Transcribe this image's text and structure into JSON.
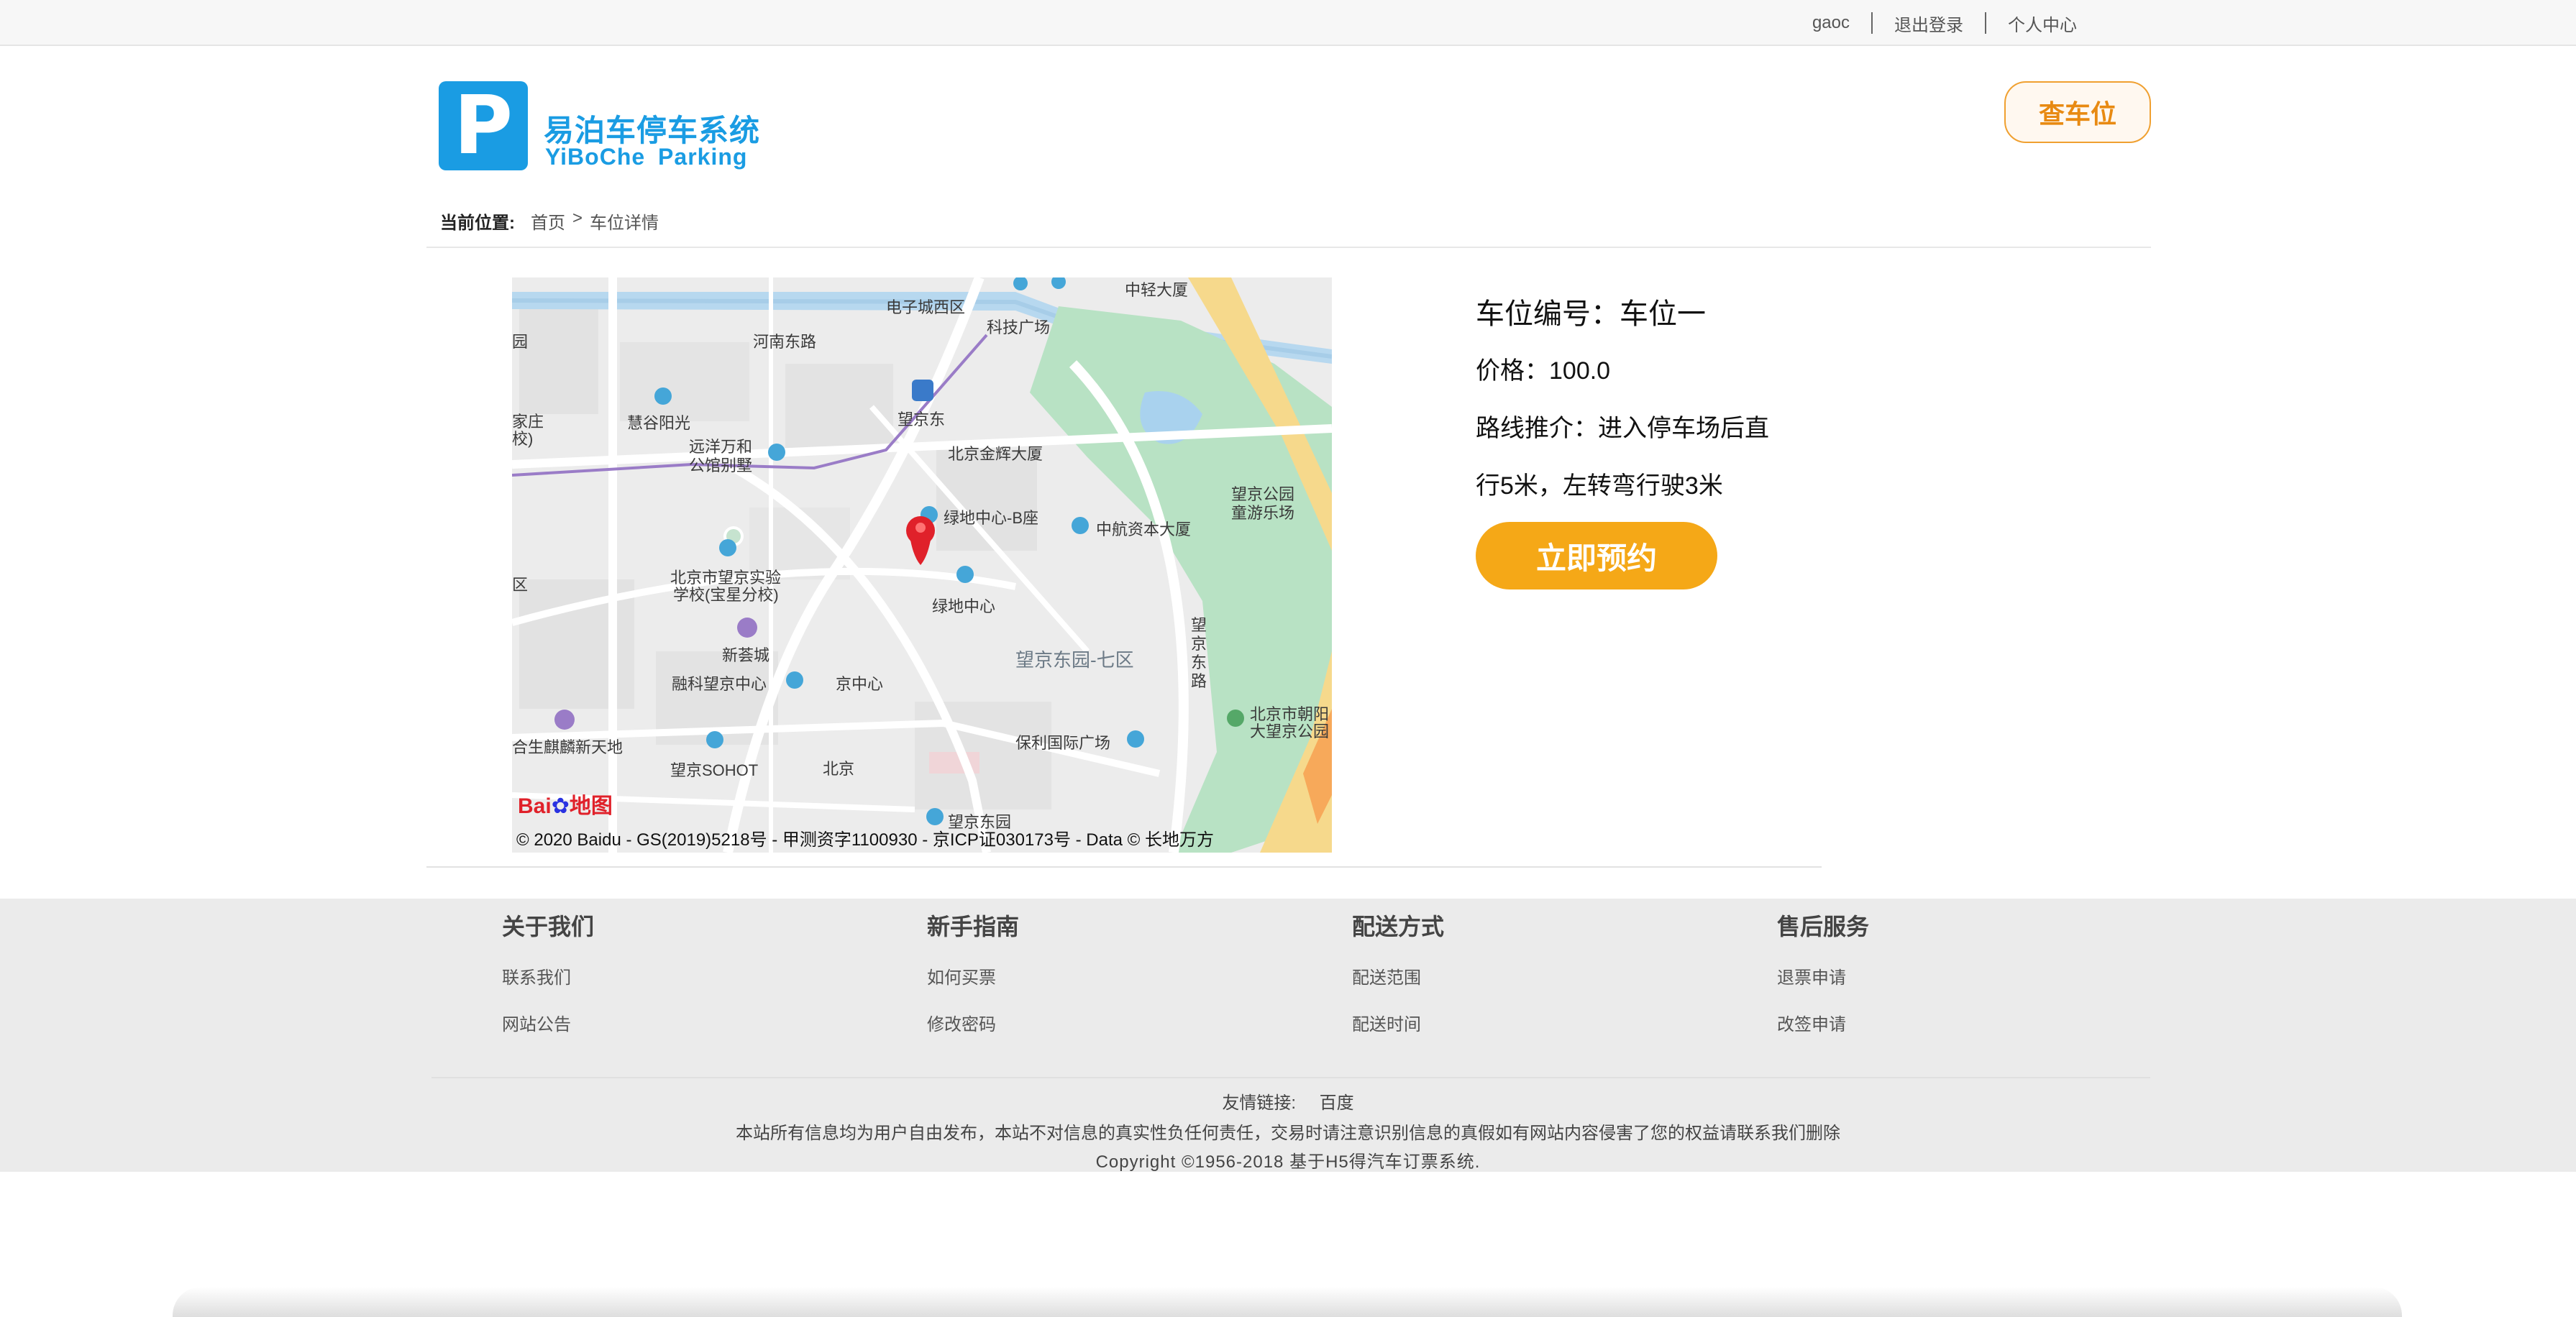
{
  "topbar": {
    "username": "gaoc",
    "logout": "退出登录",
    "profile": "个人中心"
  },
  "header": {
    "logo_letter": "P",
    "logo_cn": "易泊车停车系统",
    "logo_en": "YiBoChe Parking",
    "find_button": "查车位"
  },
  "breadcrumb": {
    "label": "当前位置:",
    "items": [
      "首页",
      "车位详情"
    ],
    "separator": ">"
  },
  "map": {
    "copyright": "© 2020 Baidu - GS(2019)5218号 - 甲测资字1100930 - 京ICP证030173号 - Data © 长地万方",
    "logo_text": "Bai",
    "logo_text2": "地图",
    "labels": [
      "河南东路",
      "电子城西区",
      "科技广场",
      "中轻大厦",
      "望京东",
      "慧谷阳光",
      "远洋万和",
      "公馆别墅",
      "家庄",
      "校)",
      "北京金辉大厦",
      "绿地中心-B座",
      "中航资本大厦",
      "望京公园",
      "童游乐场",
      "北京市望京实验",
      "学校(宝星分校)",
      "绿地中心",
      "新荟城",
      "融科望京中心",
      "京中心",
      "望京东园-七区",
      "望",
      "京",
      "东",
      "路",
      "北京市朝阳",
      "大望京公园",
      "保利国际广场",
      "合生麒麟新天地",
      "望京SOHOT",
      "北京",
      "望京东园",
      "园",
      "区"
    ]
  },
  "detail": {
    "space_no": "车位编号：车位一",
    "price": "价格：100.0",
    "route_line1": "路线推介：进入停车场后直",
    "route_line2": "行5米，左转弯行驶3米",
    "reserve_button": "立即预约"
  },
  "footer": {
    "columns": [
      {
        "title": "关于我们",
        "links": [
          "联系我们",
          "网站公告"
        ]
      },
      {
        "title": "新手指南",
        "links": [
          "如何买票",
          "修改密码"
        ]
      },
      {
        "title": "配送方式",
        "links": [
          "配送范围",
          "配送时间"
        ]
      },
      {
        "title": "售后服务",
        "links": [
          "退票申请",
          "改签申请"
        ]
      }
    ],
    "friend_label": "友情链接:",
    "friend_link": "百度",
    "notice": "本站所有信息均为用户自由发布，本站不对信息的真实性负任何责任，交易时请注意识别信息的真假如有网站内容侵害了您的权益请联系我们删除",
    "copyright": "Copyright ©1956-2018 基于H5得汽车订票系统."
  },
  "colors": {
    "brand_blue": "#1a9ce3",
    "accent_orange": "#f5a817",
    "park_green": "#b8e2c4",
    "map_pin_red": "#e0212a"
  }
}
